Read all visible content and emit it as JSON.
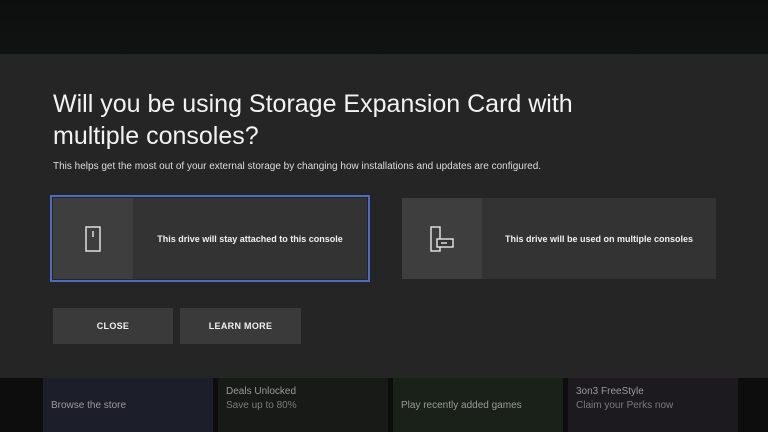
{
  "dialog": {
    "title": "Will you be using Storage Expansion Card with multiple consoles?",
    "subtitle": "This helps get the most out of your external storage by changing how installations and updates are configured.",
    "options": [
      {
        "label": "This drive will stay attached to this console",
        "icon": "console-icon",
        "selected": true
      },
      {
        "label": "This drive will be used on multiple consoles",
        "icon": "multiple-consoles-icon",
        "selected": false
      }
    ],
    "buttons": {
      "close": "CLOSE",
      "learn_more": "LEARN MORE"
    }
  },
  "background_tiles": [
    {
      "line1": "Browse the store"
    },
    {
      "line1": "Deals Unlocked",
      "line2": "Save up to 80%"
    },
    {
      "line1": "Play recently added games"
    },
    {
      "line1": "3on3 FreeStyle",
      "line2": "Claim your Perks now"
    }
  ],
  "colors": {
    "dialog_bg": "#252525",
    "option_bg": "#333333",
    "focus_outline": "#4d6bc0"
  }
}
